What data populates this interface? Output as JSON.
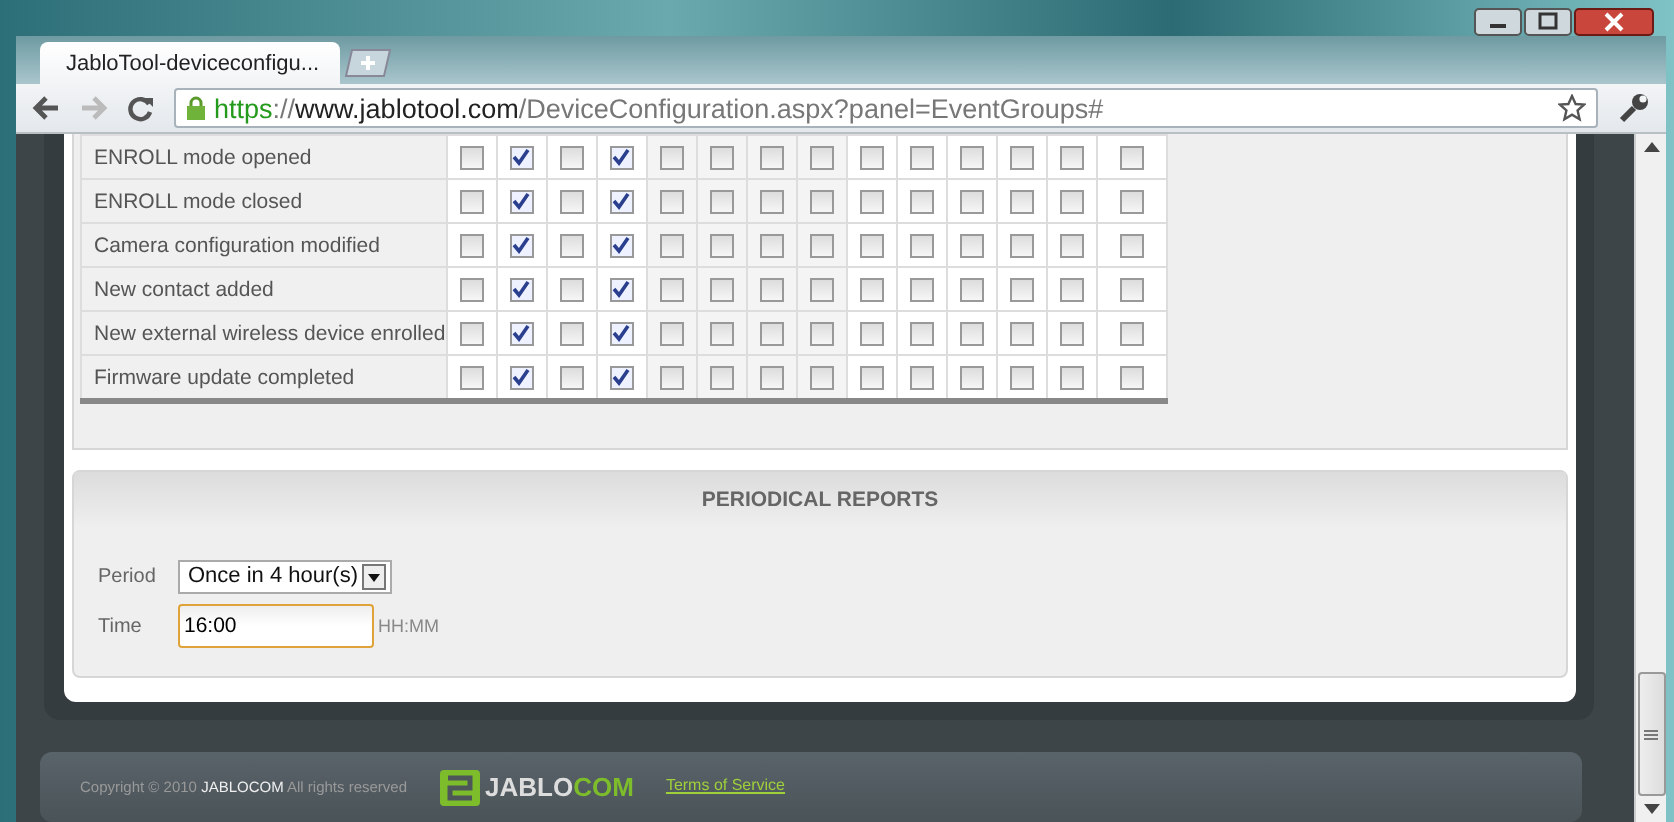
{
  "browser": {
    "tab_title": "JabloTool-deviceconfigu...",
    "url": [
      "https",
      "://",
      "www.jablotool.com",
      "/DeviceConfiguration.aspx?panel=EventGroups#"
    ]
  },
  "events": [
    {
      "label": "ENROLL mode opened",
      "checks": [
        false,
        true,
        false,
        true,
        false,
        false,
        false,
        false,
        false,
        false,
        false,
        false,
        false,
        false
      ]
    },
    {
      "label": "ENROLL mode closed",
      "checks": [
        false,
        true,
        false,
        true,
        false,
        false,
        false,
        false,
        false,
        false,
        false,
        false,
        false,
        false
      ]
    },
    {
      "label": "Camera configuration modified",
      "checks": [
        false,
        true,
        false,
        true,
        false,
        false,
        false,
        false,
        false,
        false,
        false,
        false,
        false,
        false
      ]
    },
    {
      "label": "New contact added",
      "checks": [
        false,
        true,
        false,
        true,
        false,
        false,
        false,
        false,
        false,
        false,
        false,
        false,
        false,
        false
      ]
    },
    {
      "label": "New external wireless device enrolled",
      "checks": [
        false,
        true,
        false,
        true,
        false,
        false,
        false,
        false,
        false,
        false,
        false,
        false,
        false,
        false
      ]
    },
    {
      "label": "Firmware update completed",
      "checks": [
        false,
        true,
        false,
        true,
        false,
        false,
        false,
        false,
        false,
        false,
        false,
        false,
        false,
        false
      ]
    }
  ],
  "periodical_reports": {
    "title": "PERIODICAL REPORTS",
    "period": {
      "label": "Period",
      "value": "Once in 4 hour(s)"
    },
    "time": {
      "label": "Time",
      "value": "16:00",
      "hint": "HH:MM"
    }
  },
  "footer": {
    "copyright": "Copyright © 2010 **JABLOCOM** All rights reserved",
    "logo": [
      "JABLO",
      "COM"
    ],
    "terms_link": "Terms of Service"
  }
}
